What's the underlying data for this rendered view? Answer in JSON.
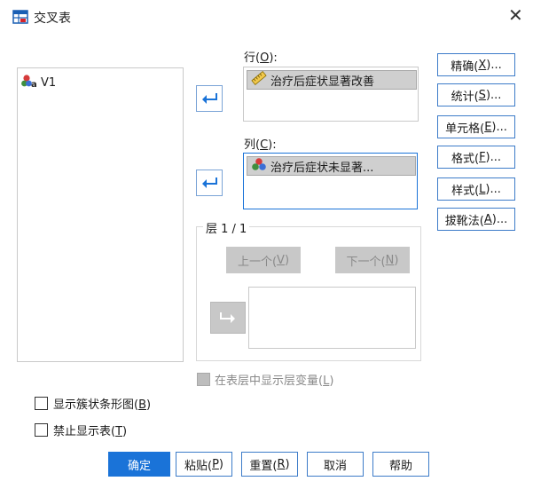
{
  "window": {
    "title": "交叉表",
    "close_icon": "close-icon"
  },
  "source_list": {
    "items": [
      {
        "label": "V1",
        "icon": "nominal-string-icon"
      }
    ]
  },
  "rows": {
    "label_prefix": "行(",
    "label_key": "O",
    "label_suffix": "):",
    "items": [
      {
        "label": "治疗后症状显著改善",
        "icon": "scale-ruler-icon"
      }
    ]
  },
  "columns": {
    "label_prefix": "列(",
    "label_key": "C",
    "label_suffix": "):",
    "items": [
      {
        "label": "治疗后症状未显著...",
        "icon": "nominal-balls-icon"
      }
    ]
  },
  "layer": {
    "title": "层 1 / 1",
    "prev_prefix": "上一个(",
    "prev_key": "V",
    "prev_suffix": ")",
    "next_prefix": "下一个(",
    "next_key": "N",
    "next_suffix": ")"
  },
  "display_layer_checkbox": {
    "prefix": "在表层中显示层变量(",
    "key": "L",
    "suffix": ")",
    "checked": false,
    "enabled": false
  },
  "side_buttons": [
    {
      "prefix": "精确(",
      "key": "X",
      "suffix": ")..."
    },
    {
      "prefix": "统计(",
      "key": "S",
      "suffix": ")..."
    },
    {
      "prefix": "单元格(",
      "key": "E",
      "suffix": ")..."
    },
    {
      "prefix": "格式(",
      "key": "F",
      "suffix": ")..."
    },
    {
      "prefix": "样式(",
      "key": "L",
      "suffix": ")..."
    },
    {
      "prefix": "拔靴法(",
      "key": "A",
      "suffix": ")..."
    }
  ],
  "checkbox_clustered_bar": {
    "prefix": "显示簇状条形图(",
    "key": "B",
    "suffix": ")",
    "checked": false
  },
  "checkbox_suppress_tables": {
    "prefix": "禁止显示表(",
    "key": "T",
    "suffix": ")",
    "checked": false
  },
  "bottom_buttons": {
    "ok": "确定",
    "paste": {
      "prefix": "粘贴(",
      "key": "P",
      "suffix": ")"
    },
    "reset": {
      "prefix": "重置(",
      "key": "R",
      "suffix": ")"
    },
    "cancel": "取消",
    "help": "帮助"
  },
  "colors": {
    "accent": "#1a73d8",
    "button_border": "#3d7cc9",
    "arrow_blue": "#1a73d8",
    "disabled": "#c8c8c8"
  }
}
